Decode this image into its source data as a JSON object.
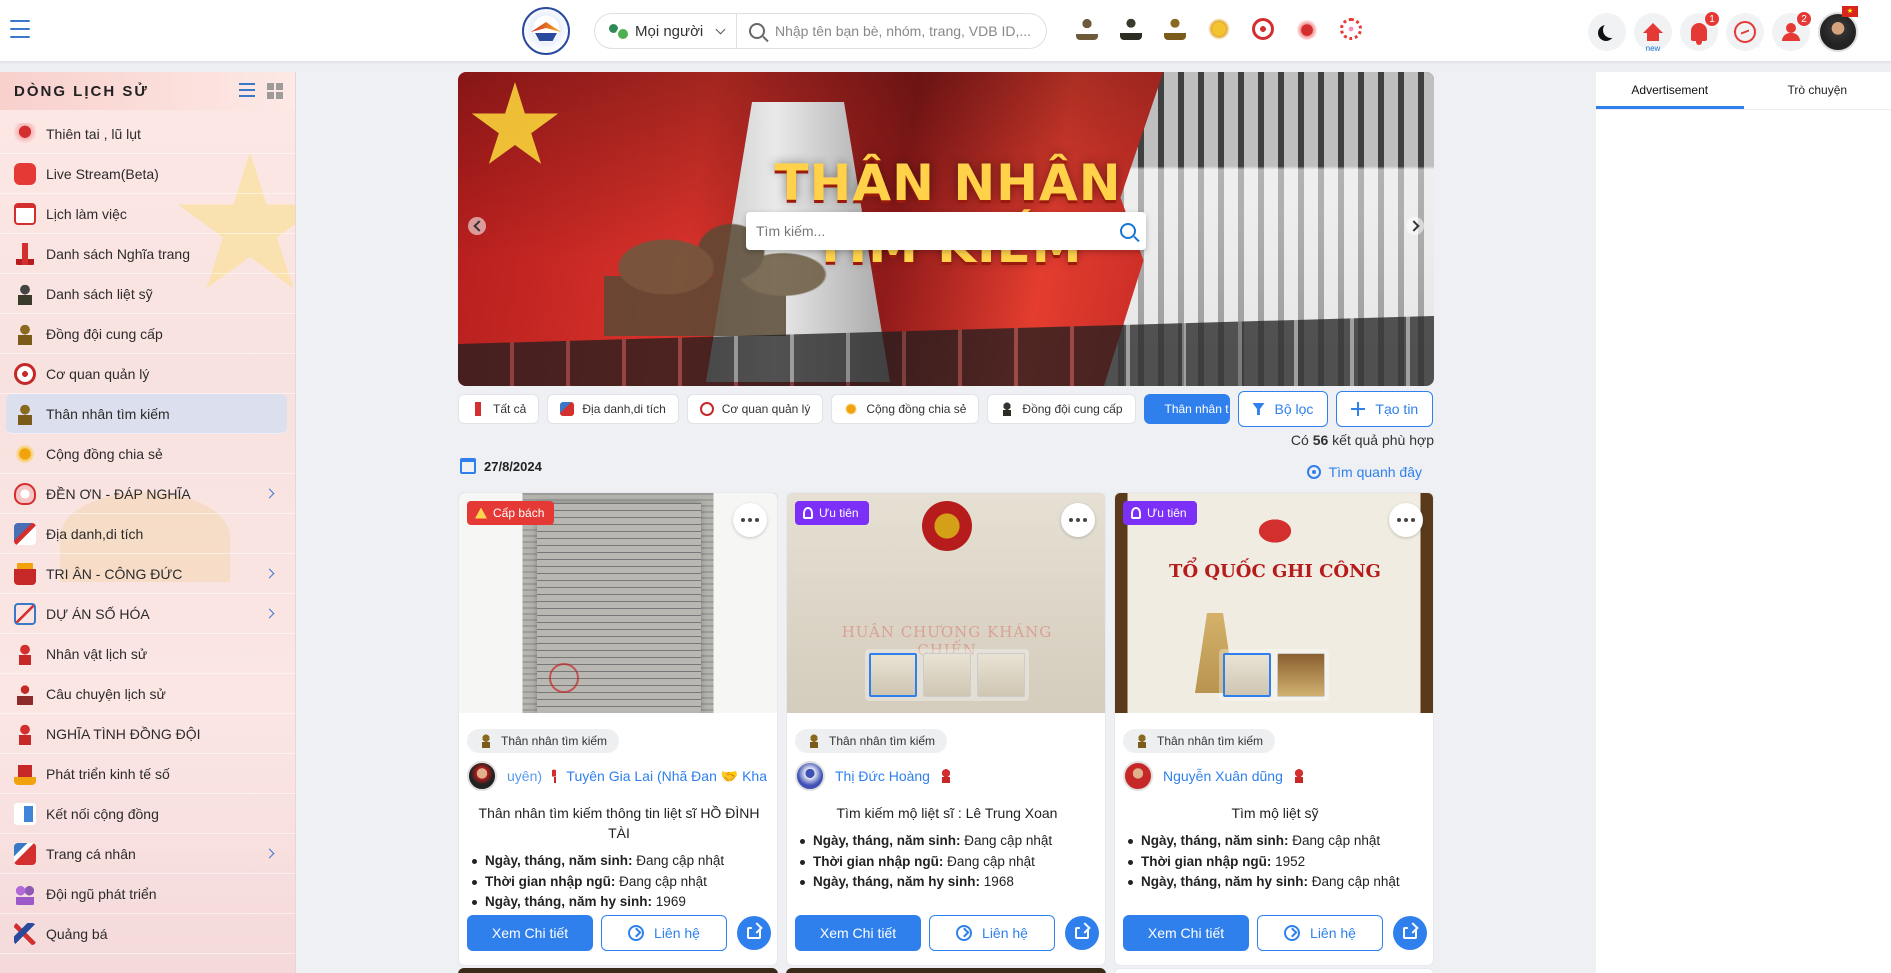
{
  "topbar": {
    "audience_label": "Mọi người",
    "search_placeholder": "Nhập tên bạn bè, nhóm, trang, VDB ID,...",
    "home_new_label": "new",
    "notif_badge": "1",
    "users_badge": "2"
  },
  "sidebar": {
    "title": "DÒNG LỊCH SỬ",
    "items": [
      {
        "label": "Thiên tai , lũ lụt",
        "icon": "disaster-icon",
        "arrow": false,
        "active": false
      },
      {
        "label": "Live Stream(Beta)",
        "icon": "live-stream-icon",
        "arrow": false,
        "active": false
      },
      {
        "label": "Lịch làm việc",
        "icon": "calendar-icon",
        "arrow": false,
        "active": false
      },
      {
        "label": "Danh sách Nghĩa trang",
        "icon": "cemetery-icon",
        "arrow": false,
        "active": false
      },
      {
        "label": "Danh sách liệt sỹ",
        "icon": "martyr-icon",
        "arrow": false,
        "active": false
      },
      {
        "label": "Đồng đội cung cấp",
        "icon": "comrade-icon",
        "arrow": false,
        "active": false
      },
      {
        "label": "Cơ quan quản lý",
        "icon": "agency-seal-icon",
        "arrow": false,
        "active": false
      },
      {
        "label": "Thân nhân tìm kiếm",
        "icon": "relative-search-icon",
        "arrow": false,
        "active": true
      },
      {
        "label": "Cộng đồng chia sẻ",
        "icon": "community-icon",
        "arrow": false,
        "active": false
      },
      {
        "label": "ĐỀN ƠN - ĐÁP NGHĨA",
        "icon": "gratitude-icon",
        "arrow": true,
        "active": false
      },
      {
        "label": "Địa danh,di tích",
        "icon": "landmark-icon",
        "arrow": false,
        "active": false
      },
      {
        "label": "TRI ÂN - CÔNG ĐỨC",
        "icon": "temple-icon",
        "arrow": true,
        "active": false
      },
      {
        "label": "DỰ ÁN SỐ HÓA",
        "icon": "digitization-icon",
        "arrow": true,
        "active": false
      },
      {
        "label": "Nhân vật lịch sử",
        "icon": "historical-figure-icon",
        "arrow": false,
        "active": false
      },
      {
        "label": "Câu chuyện lịch sử",
        "icon": "history-story-icon",
        "arrow": false,
        "active": false
      },
      {
        "label": "NGHĨA TÌNH ĐỒNG ĐỘI",
        "icon": "comradeship-icon",
        "arrow": false,
        "active": false
      },
      {
        "label": "Phát triển kinh tế số",
        "icon": "digital-economy-icon",
        "arrow": false,
        "active": false
      },
      {
        "label": "Kết nối cộng đồng",
        "icon": "community-connect-icon",
        "arrow": false,
        "active": false
      },
      {
        "label": "Trang cá nhân",
        "icon": "profile-icon",
        "arrow": true,
        "active": false
      },
      {
        "label": "Đội ngũ phát triển",
        "icon": "dev-team-icon",
        "arrow": false,
        "active": false
      },
      {
        "label": "Quảng bá",
        "icon": "promotion-icon",
        "arrow": false,
        "active": false
      }
    ]
  },
  "banner": {
    "title_line1": "THÂN NHÂN",
    "title_line2": "TÌM KIẾM",
    "search_placeholder": "Tìm kiếm..."
  },
  "filters": {
    "chips": [
      "Tất cả",
      "Địa danh,di tích",
      "Cơ quan quản lý",
      "Cộng đồng chia sẻ",
      "Đồng đội cung cấp",
      "Thân nhân tìm kiếm"
    ],
    "filter_button": "Bộ lọc",
    "create_button": "Tạo tin"
  },
  "results": {
    "prefix": "Có",
    "count": "56",
    "suffix": "kết quả phù hợp"
  },
  "date": "27/8/2024",
  "nearby_label": "Tìm quanh đây",
  "cards": [
    {
      "tag": "Cấp bách",
      "category": "Thân nhân tìm kiếm",
      "author_prefix": "uyên)",
      "author": "Tuyên Gia Lai (Nhã Đan 🤝 Kha",
      "title": "Thân nhân tìm kiếm thông tin liệt sĩ HỒ ĐÌNH TÀI",
      "info": [
        {
          "k": "Ngày, tháng, năm sinh:",
          "v": "Đang cập nhật"
        },
        {
          "k": "Thời gian nhập ngũ:",
          "v": "Đang cập nhật"
        },
        {
          "k": "Ngày, tháng, năm hy sinh:",
          "v": "1969"
        }
      ],
      "detail_button": "Xem Chi tiết",
      "contact_button": "Liên hệ"
    },
    {
      "tag": "Ưu tiên",
      "category": "Thân nhân tìm kiếm",
      "author": "Thị Đức Hoàng",
      "title": "Tìm kiếm mộ liệt sĩ : Lê Trung Xoan",
      "image_text": "HUÂN CHƯƠNG KHÁNG CHIẾN",
      "info": [
        {
          "k": "Ngày, tháng, năm sinh:",
          "v": "Đang cập nhật"
        },
        {
          "k": "Thời gian nhập ngũ:",
          "v": "Đang cập nhật"
        },
        {
          "k": "Ngày, tháng, năm hy sinh:",
          "v": "1968"
        }
      ],
      "detail_button": "Xem Chi tiết",
      "contact_button": "Liên hệ"
    },
    {
      "tag": "Ưu tiên",
      "category": "Thân nhân tìm kiếm",
      "author": "Nguyễn Xuân dũng",
      "title": "Tìm mộ liệt sỹ",
      "image_text": "TỔ QUỐC GHI CÔNG",
      "info": [
        {
          "k": "Ngày, tháng, năm sinh:",
          "v": "Đang cập nhật"
        },
        {
          "k": "Thời gian nhập ngũ:",
          "v": "1952"
        },
        {
          "k": "Ngày, tháng, năm hy sinh:",
          "v": "Đang cập nhật"
        }
      ],
      "detail_button": "Xem Chi tiết",
      "contact_button": "Liên hệ"
    }
  ],
  "right_panel": {
    "tabs": [
      "Advertisement",
      "Trò chuyện"
    ]
  }
}
